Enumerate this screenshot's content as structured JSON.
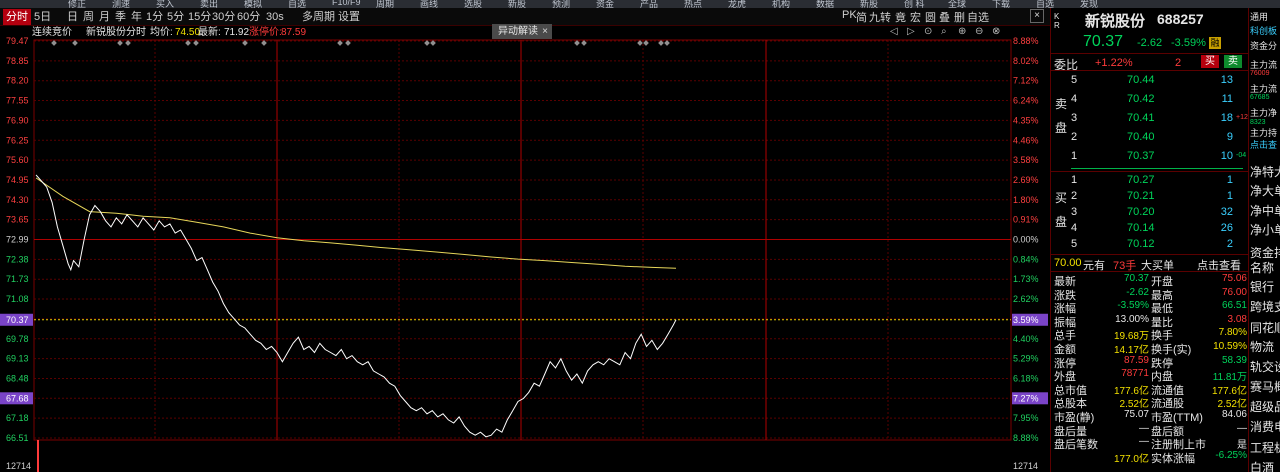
{
  "topbar": {
    "items": [
      "修正",
      "测速",
      "买入",
      "卖出",
      "模拟",
      "自选",
      "F10/F9",
      "周期",
      "画线",
      "选股",
      "新股",
      "预测",
      "资金",
      "产品",
      "热点",
      "龙虎",
      "机构",
      "数据",
      "新股",
      "创 科",
      "全球",
      "下载",
      "自选",
      "发现"
    ]
  },
  "tabs": [
    "分时",
    "5日",
    "日",
    "周",
    "月",
    "季",
    "年",
    "1分",
    "5分",
    "15分",
    "30分",
    "60分",
    "30s",
    "多周期",
    "设置"
  ],
  "right_tools": [
    "PK",
    "简",
    "九转",
    "竟",
    "宏",
    "圆",
    "叠",
    "删",
    "自选",
    "Y"
  ],
  "info": {
    "mode": "连续竞价",
    "stock": "新锐股份",
    "chart_name": "分时",
    "avg_label": "均价:",
    "avg_value": "74.50",
    "last_label": "最新:",
    "last_value": "71.92",
    "limit_label": "涨停价:",
    "limit_value": "87.59"
  },
  "notice": {
    "label": "异动解读",
    "close": "×"
  },
  "tool_icons": [
    "◁",
    "▷",
    "⊙",
    "⌕",
    "⊕",
    "⊖",
    "⊗"
  ],
  "chart_data": {
    "type": "line",
    "y_left_labels": [
      "79.47",
      "78.85",
      "78.20",
      "77.55",
      "76.90",
      "76.25",
      "75.60",
      "74.95",
      "74.30",
      "73.65",
      "72.99",
      "72.38",
      "71.73",
      "71.08",
      "70.37",
      "69.78",
      "69.13",
      "68.48",
      "67.68",
      "67.18",
      "66.51"
    ],
    "y_right_labels": [
      "8.88%",
      "8.02%",
      "7.12%",
      "6.24%",
      "4.35%",
      "4.46%",
      "3.58%",
      "2.69%",
      "1.80%",
      "0.91%",
      "0.00%",
      "0.84%",
      "1.73%",
      "2.62%",
      "3.59%",
      "4.40%",
      "5.29%",
      "6.18%",
      "7.27%",
      "7.95%",
      "8.88%"
    ],
    "ylim": [
      66.51,
      79.47
    ],
    "prev_close": 72.99,
    "current": 70.37,
    "current_pct": "3.59%",
    "low_marker": "67.68",
    "low_marker_pct": "7.27%",
    "bottom_left": "12714",
    "bottom_right": "12714",
    "price": [
      [
        0,
        75.1
      ],
      [
        2,
        74.9
      ],
      [
        4,
        74.7
      ],
      [
        6,
        74.2
      ],
      [
        8,
        73.4
      ],
      [
        10,
        72.8
      ],
      [
        12,
        72.2
      ],
      [
        13,
        72.0
      ],
      [
        14,
        72.3
      ],
      [
        16,
        72.1
      ],
      [
        18,
        73.0
      ],
      [
        20,
        73.8
      ],
      [
        22,
        74.1
      ],
      [
        24,
        73.9
      ],
      [
        26,
        73.6
      ],
      [
        28,
        73.4
      ],
      [
        30,
        73.7
      ],
      [
        32,
        73.5
      ],
      [
        34,
        73.8
      ],
      [
        36,
        73.6
      ],
      [
        38,
        73.4
      ],
      [
        40,
        73.7
      ],
      [
        42,
        73.5
      ],
      [
        44,
        73.3
      ],
      [
        46,
        73.6
      ],
      [
        48,
        73.4
      ],
      [
        50,
        73.5
      ],
      [
        52,
        73.2
      ],
      [
        54,
        73.3
      ],
      [
        56,
        73.0
      ],
      [
        58,
        72.7
      ],
      [
        60,
        72.3
      ],
      [
        62,
        72.4
      ],
      [
        64,
        72.0
      ],
      [
        66,
        71.6
      ],
      [
        68,
        71.3
      ],
      [
        70,
        70.9
      ],
      [
        72,
        70.6
      ],
      [
        74,
        70.4
      ],
      [
        76,
        70.2
      ],
      [
        78,
        70.1
      ],
      [
        80,
        69.9
      ],
      [
        82,
        69.7
      ],
      [
        84,
        69.6
      ],
      [
        86,
        69.4
      ],
      [
        88,
        69.5
      ],
      [
        90,
        69.3
      ],
      [
        92,
        69.0
      ],
      [
        94,
        69.3
      ],
      [
        96,
        69.6
      ],
      [
        98,
        69.8
      ],
      [
        100,
        69.4
      ],
      [
        102,
        69.5
      ],
      [
        104,
        69.3
      ],
      [
        106,
        69.6
      ],
      [
        108,
        69.4
      ],
      [
        110,
        69.3
      ],
      [
        112,
        69.2
      ],
      [
        114,
        69.4
      ],
      [
        116,
        69.1
      ],
      [
        118,
        69.2
      ],
      [
        120,
        69.0
      ],
      [
        122,
        68.9
      ],
      [
        124,
        69.0
      ],
      [
        126,
        68.7
      ],
      [
        128,
        68.6
      ],
      [
        130,
        68.5
      ],
      [
        132,
        68.3
      ],
      [
        134,
        68.2
      ],
      [
        136,
        67.9
      ],
      [
        138,
        67.7
      ],
      [
        140,
        67.5
      ],
      [
        142,
        67.4
      ],
      [
        144,
        67.5
      ],
      [
        146,
        67.3
      ],
      [
        148,
        67.4
      ],
      [
        150,
        67.2
      ],
      [
        152,
        67.3
      ],
      [
        154,
        67.1
      ],
      [
        156,
        67.0
      ],
      [
        158,
        67.2
      ],
      [
        160,
        66.9
      ],
      [
        162,
        66.7
      ],
      [
        164,
        66.6
      ],
      [
        166,
        66.7
      ],
      [
        168,
        66.55
      ],
      [
        170,
        66.6
      ],
      [
        172,
        66.8
      ],
      [
        174,
        66.7
      ],
      [
        176,
        67.1
      ],
      [
        178,
        67.4
      ],
      [
        180,
        67.7
      ],
      [
        182,
        67.8
      ],
      [
        184,
        68.0
      ],
      [
        186,
        68.3
      ],
      [
        188,
        68.2
      ],
      [
        190,
        68.6
      ],
      [
        192,
        69.0
      ],
      [
        194,
        68.8
      ],
      [
        196,
        69.1
      ],
      [
        198,
        68.7
      ],
      [
        200,
        68.4
      ],
      [
        202,
        68.6
      ],
      [
        204,
        68.3
      ],
      [
        206,
        68.7
      ],
      [
        208,
        68.9
      ],
      [
        210,
        69.0
      ],
      [
        212,
        68.9
      ],
      [
        214,
        69.1
      ],
      [
        216,
        69.0
      ],
      [
        218,
        68.9
      ],
      [
        220,
        69.3
      ],
      [
        222,
        69.1
      ],
      [
        224,
        69.6
      ],
      [
        226,
        69.9
      ],
      [
        228,
        69.5
      ],
      [
        230,
        69.7
      ],
      [
        232,
        69.4
      ],
      [
        234,
        69.6
      ],
      [
        236,
        69.9
      ],
      [
        238,
        70.2
      ],
      [
        239,
        70.37
      ]
    ],
    "avg": [
      [
        0,
        75.0
      ],
      [
        10,
        74.4
      ],
      [
        20,
        73.9
      ],
      [
        30,
        73.85
      ],
      [
        40,
        73.75
      ],
      [
        50,
        73.7
      ],
      [
        60,
        73.55
      ],
      [
        70,
        73.4
      ],
      [
        80,
        73.2
      ],
      [
        90,
        73.05
      ],
      [
        100,
        72.95
      ],
      [
        110,
        72.88
      ],
      [
        120,
        72.8
      ],
      [
        130,
        72.72
      ],
      [
        140,
        72.65
      ],
      [
        150,
        72.58
      ],
      [
        160,
        72.5
      ],
      [
        170,
        72.42
      ],
      [
        180,
        72.35
      ],
      [
        190,
        72.3
      ],
      [
        200,
        72.24
      ],
      [
        210,
        72.18
      ],
      [
        220,
        72.12
      ],
      [
        230,
        72.08
      ],
      [
        239,
        72.05
      ]
    ]
  },
  "right": {
    "header": {
      "corner": "K R",
      "name": "新锐股份",
      "code": "688257",
      "price": "70.37",
      "change": "-2.62",
      "pct": "-3.59%",
      "badge": "融"
    },
    "weibi": {
      "label": "委比",
      "value": "+1.22%",
      "num": "2",
      "buy": "买",
      "sell": "卖"
    },
    "sell_label": "卖盘",
    "buy_label": "买盘",
    "asks": [
      {
        "lvl": "5",
        "price": "70.44",
        "vol": "13",
        "extra": ""
      },
      {
        "lvl": "4",
        "price": "70.42",
        "vol": "11",
        "extra": ""
      },
      {
        "lvl": "3",
        "price": "70.41",
        "vol": "18",
        "extra": "+12"
      },
      {
        "lvl": "2",
        "price": "70.40",
        "vol": "9",
        "extra": ""
      },
      {
        "lvl": "1",
        "price": "70.37",
        "vol": "10",
        "extra": "-04"
      }
    ],
    "bids": [
      {
        "lvl": "1",
        "price": "70.27",
        "vol": "1"
      },
      {
        "lvl": "2",
        "price": "70.21",
        "vol": "1"
      },
      {
        "lvl": "3",
        "price": "70.20",
        "vol": "32"
      },
      {
        "lvl": "4",
        "price": "70.14",
        "vol": "26"
      },
      {
        "lvl": "5",
        "price": "70.12",
        "vol": "2"
      }
    ],
    "bigorder": {
      "price": "70.00",
      "unit": "元有",
      "vol": "73手",
      "label": "大买单",
      "link": "点击查看"
    },
    "stats": [
      {
        "l": "最新",
        "v": "70.37",
        "vc": "green",
        "l2": "开盘",
        "v2": "75.06",
        "vc2": "red"
      },
      {
        "l": "涨跌",
        "v": "-2.62",
        "vc": "green",
        "l2": "最高",
        "v2": "76.00",
        "vc2": "red"
      },
      {
        "l": "涨幅",
        "v": "-3.59%",
        "vc": "green",
        "l2": "最低",
        "v2": "66.51",
        "vc2": "green"
      },
      {
        "l": "振幅",
        "v": "13.00%",
        "vc": "white",
        "l2": "量比",
        "v2": "3.08",
        "vc2": "red"
      },
      {
        "l": "总手",
        "v": "19.68万",
        "vc": "yellow",
        "l2": "换手",
        "v2": "7.80%",
        "vc2": "yellow"
      },
      {
        "l": "金额",
        "v": "14.17亿",
        "vc": "yellow",
        "l2": "换手(实)",
        "v2": "10.59%",
        "vc2": "yellow"
      },
      {
        "l": "涨停",
        "v": "87.59",
        "vc": "red",
        "l2": "跌停",
        "v2": "58.39",
        "vc2": "green"
      },
      {
        "l": "外盘",
        "v": "78771",
        "vc": "red",
        "l2": "内盘",
        "v2": "11.81万",
        "vc2": "green"
      },
      {
        "l": "总市值",
        "v": "177.6亿",
        "vc": "yellow",
        "l2": "流通值",
        "v2": "177.6亿",
        "vc2": "yellow"
      },
      {
        "l": "总股本",
        "v": "2.52亿",
        "vc": "yellow",
        "l2": "流通股",
        "v2": "2.52亿",
        "vc2": "yellow"
      },
      {
        "l": "市盈(静)",
        "v": "75.07",
        "vc": "white",
        "l2": "市盈(TTM)",
        "v2": "84.06",
        "vc2": "white"
      },
      {
        "l": "盘后量",
        "v": "—",
        "vc": "white",
        "l2": "盘后额",
        "v2": "—",
        "vc2": "white"
      },
      {
        "l": "盘后笔数",
        "v": "—",
        "vc": "white",
        "l2": "注册制上市",
        "v2": "是",
        "vc2": "white"
      },
      {
        "l": "",
        "v": "177.0亿",
        "vc": "yellow",
        "l2": "实体涨幅",
        "v2": "-6.25%",
        "vc2": "green"
      }
    ]
  },
  "side": {
    "items": [
      "通用",
      "科创板",
      "资金分",
      "主力流",
      "76009",
      "主力流",
      "67685",
      "主力净",
      "8323",
      "主力持",
      "点击查",
      "净特大",
      "净大单",
      "净中单",
      "净小单",
      "资金排",
      "名称",
      "银行",
      "跨境支",
      "同花顺",
      "物流",
      "轨交设",
      "赛马概",
      "超级品",
      "消费电",
      "工程机",
      "白酒"
    ]
  }
}
